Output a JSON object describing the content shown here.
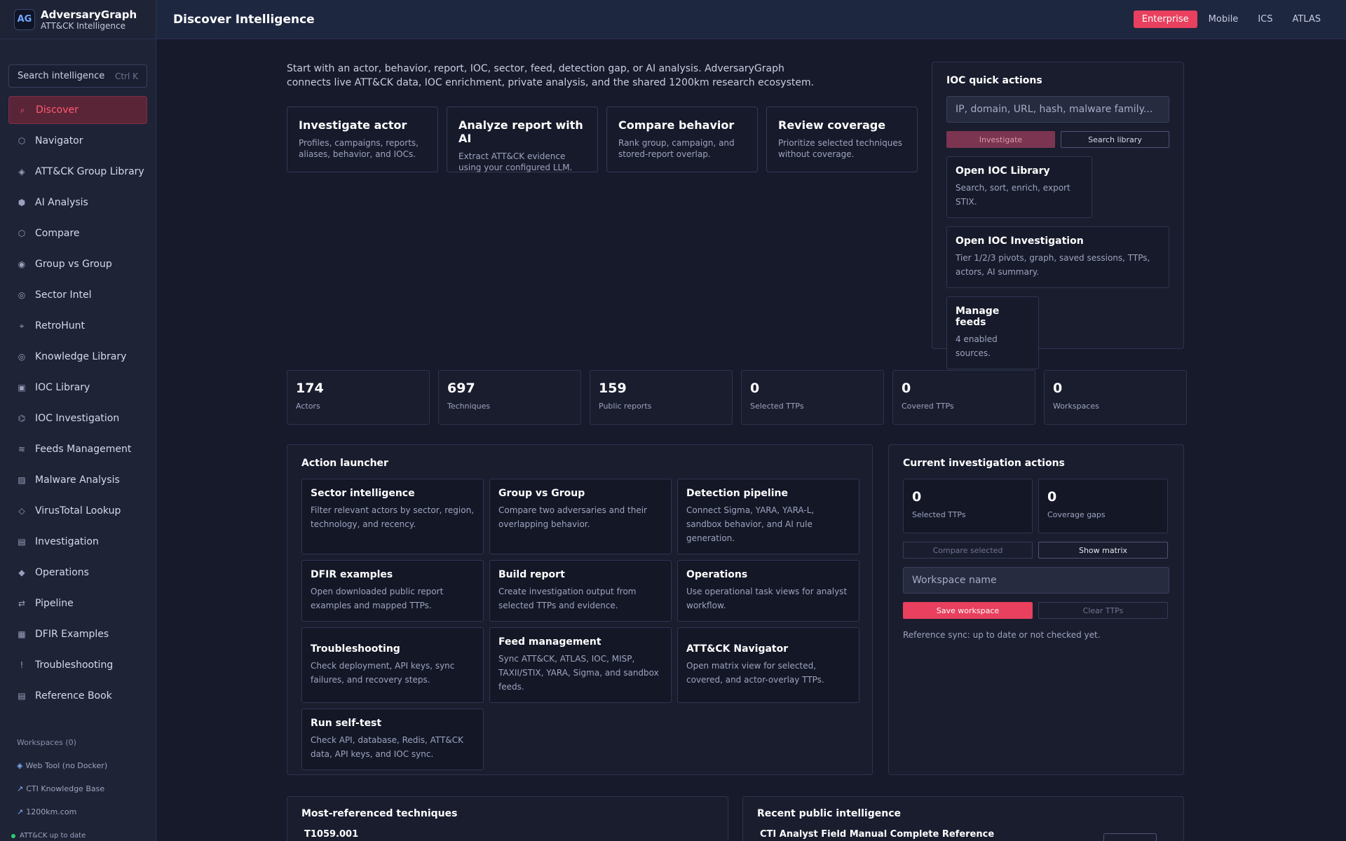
{
  "brand": {
    "name": "AdversaryGraph",
    "subtitle": "ATT&CK Intelligence",
    "logo_text": "AG"
  },
  "search": {
    "placeholder": "Search intelligence",
    "shortcut": "Ctrl K"
  },
  "nav": [
    {
      "label": "Discover",
      "icon": "⌕",
      "active": true
    },
    {
      "label": "Navigator",
      "icon": "⬡"
    },
    {
      "label": "ATT&CK Group Library",
      "icon": "◈"
    },
    {
      "label": "AI Analysis",
      "icon": "⬢"
    },
    {
      "label": "Compare",
      "icon": "⬡"
    },
    {
      "label": "Group vs Group",
      "icon": "◉"
    },
    {
      "label": "Sector Intel",
      "icon": "◎"
    },
    {
      "label": "RetroHunt",
      "icon": "⌖"
    },
    {
      "label": "Knowledge Library",
      "icon": "◎"
    },
    {
      "label": "IOC Library",
      "icon": "▣"
    },
    {
      "label": "IOC Investigation",
      "icon": "⌬"
    },
    {
      "label": "Feeds Management",
      "icon": "≋"
    },
    {
      "label": "Malware Analysis",
      "icon": "▨"
    },
    {
      "label": "VirusTotal Lookup",
      "icon": "◇"
    },
    {
      "label": "Investigation",
      "icon": "▤"
    },
    {
      "label": "Operations",
      "icon": "◆"
    },
    {
      "label": "Pipeline",
      "icon": "⇄"
    },
    {
      "label": "DFIR Examples",
      "icon": "▦"
    },
    {
      "label": "Troubleshooting",
      "icon": "!"
    },
    {
      "label": "Reference Book",
      "icon": "▤"
    }
  ],
  "workspaces_label": "Workspaces (0)",
  "external_links": [
    {
      "label": "Web Tool (no Docker)",
      "icon": "◈"
    },
    {
      "label": "CTI Knowledge Base",
      "icon": "↗"
    },
    {
      "label": "1200km.com",
      "icon": "↗"
    }
  ],
  "status_text": "ATT&CK up to date",
  "topbar": {
    "title": "Discover Intelligence",
    "envs": [
      "Enterprise",
      "Mobile",
      "ICS",
      "ATLAS"
    ],
    "active_env": "Enterprise"
  },
  "intro": "Start with an actor, behavior, report, IOC, sector, feed, detection gap, or AI analysis. AdversaryGraph connects live ATT&CK data, IOC enrichment, private analysis, and the shared 1200km research ecosystem.",
  "quick_cards": [
    {
      "title": "Investigate actor",
      "desc": "Profiles, campaigns, reports, aliases, behavior, and IOCs."
    },
    {
      "title": "Analyze report with AI",
      "desc": "Extract ATT&CK evidence using your configured LLM."
    },
    {
      "title": "Compare behavior",
      "desc": "Rank group, campaign, and stored-report overlap."
    },
    {
      "title": "Review coverage",
      "desc": "Prioritize selected techniques without coverage."
    }
  ],
  "ioc": {
    "title": "IOC quick actions",
    "placeholder": "IP, domain, URL, hash, malware family...",
    "investigate_label": "Investigate",
    "search_label": "Search library",
    "cards": [
      {
        "title": "Open IOC Library",
        "desc": "Search, sort, enrich, export STIX."
      },
      {
        "title": "Open IOC Investigation",
        "desc": "Tier 1/2/3 pivots, graph, saved sessions, TTPs, actors, AI summary."
      },
      {
        "title": "Manage feeds",
        "desc": "4 enabled sources."
      }
    ]
  },
  "stats": [
    {
      "value": "174",
      "label": "Actors"
    },
    {
      "value": "697",
      "label": "Techniques"
    },
    {
      "value": "159",
      "label": "Public reports"
    },
    {
      "value": "0",
      "label": "Selected TTPs"
    },
    {
      "value": "0",
      "label": "Covered TTPs"
    },
    {
      "value": "0",
      "label": "Workspaces"
    }
  ],
  "launcher": {
    "title": "Action launcher",
    "items": [
      {
        "title": "Sector intelligence",
        "desc": "Filter relevant actors by sector, region, technology, and recency."
      },
      {
        "title": "Group vs Group",
        "desc": "Compare two adversaries and their overlapping behavior."
      },
      {
        "title": "Detection pipeline",
        "desc": "Connect Sigma, YARA, YARA-L, sandbox behavior, and AI rule generation."
      },
      {
        "title": "DFIR examples",
        "desc": "Open downloaded public report examples and mapped TTPs."
      },
      {
        "title": "Build report",
        "desc": "Create investigation output from selected TTPs and evidence."
      },
      {
        "title": "Operations",
        "desc": "Use operational task views for analyst workflow."
      },
      {
        "title": "Troubleshooting",
        "desc": "Check deployment, API keys, sync failures, and recovery steps."
      },
      {
        "title": "Feed management",
        "desc": "Sync ATT&CK, ATLAS, IOC, MISP, TAXII/STIX, YARA, Sigma, and sandbox feeds."
      },
      {
        "title": "ATT&CK Navigator",
        "desc": "Open matrix view for selected, covered, and actor-overlay TTPs."
      },
      {
        "title": "Run self-test",
        "desc": "Check API, database, Redis, ATT&CK data, API keys, and IOC sync."
      }
    ]
  },
  "current": {
    "title": "Current investigation actions",
    "stats": [
      {
        "value": "0",
        "label": "Selected TTPs"
      },
      {
        "value": "0",
        "label": "Coverage gaps"
      }
    ],
    "compare_label": "Compare selected",
    "matrix_label": "Show matrix",
    "workspace_placeholder": "Workspace name",
    "save_label": "Save workspace",
    "clear_label": "Clear TTPs",
    "sync_text": "Reference sync: up to date or not checked yet."
  },
  "bottom": {
    "left_title": "Most-referenced techniques",
    "left_item": "T1059.001",
    "right_title": "Recent public intelligence",
    "right_item": "CTI Analyst Field Manual Complete Reference"
  }
}
